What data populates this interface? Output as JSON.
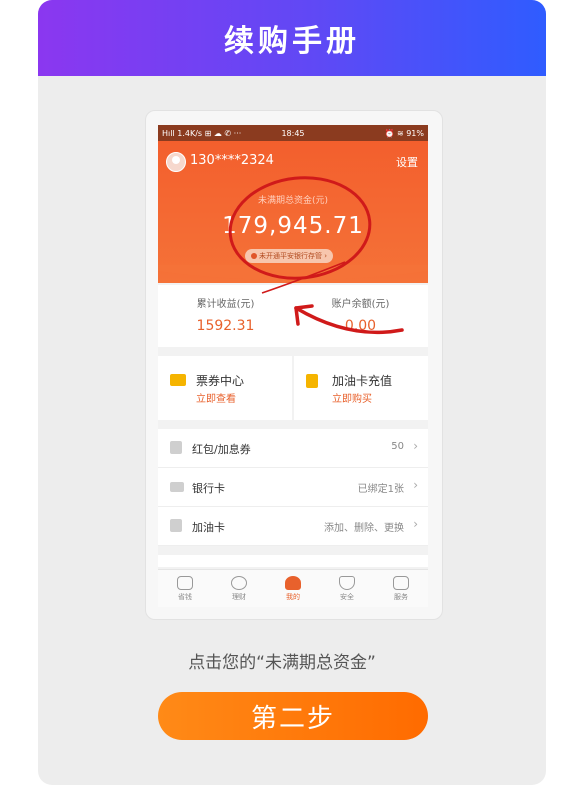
{
  "banner": {
    "title": "续购手册"
  },
  "status_bar": {
    "left": "Hıll 1.4K/s ⊞ ☁ ✆ ···",
    "time": "18:45",
    "right": "⏰ ≋ 91%"
  },
  "header": {
    "phone": "130****2324",
    "settings": "设置"
  },
  "asset": {
    "label": "未满期总资金(元)",
    "value": "179,945.71",
    "pill": "未开通平安银行存管 ›"
  },
  "stats": {
    "earnings_label": "累计收益(元)",
    "earnings_value": "1592.31",
    "balance_label": "账户余额(元)",
    "balance_value": "0.00"
  },
  "tiles": [
    {
      "title": "票券中心",
      "sub": "立即查看",
      "icon": "ticket-icon",
      "color": "#f5b400"
    },
    {
      "title": "加油卡充值",
      "sub": "立即购买",
      "icon": "fuel-icon",
      "color": "#f5b400"
    }
  ],
  "rows": [
    {
      "label": "红包/加息券",
      "value": "50",
      "icon": "red-envelope-icon"
    },
    {
      "label": "银行卡",
      "value": "已绑定1张",
      "icon": "bank-card-icon"
    },
    {
      "label": "加油卡",
      "value": "添加、删除、更换",
      "icon": "fuel-card-icon"
    }
  ],
  "tabbar": [
    {
      "label": "省钱",
      "icon": "coffee-icon"
    },
    {
      "label": "理财",
      "icon": "yuan-icon"
    },
    {
      "label": "我的",
      "icon": "person-icon",
      "active": true
    },
    {
      "label": "安全",
      "icon": "shield-icon"
    },
    {
      "label": "服务",
      "icon": "star-box-icon"
    }
  ],
  "caption": "点击您的“未满期总资金”",
  "step_button": "第二步",
  "colors": {
    "accent": "#e8612c",
    "banner_from": "#8b37f0",
    "banner_to": "#2f5cff",
    "button": "#ff7a0a"
  }
}
